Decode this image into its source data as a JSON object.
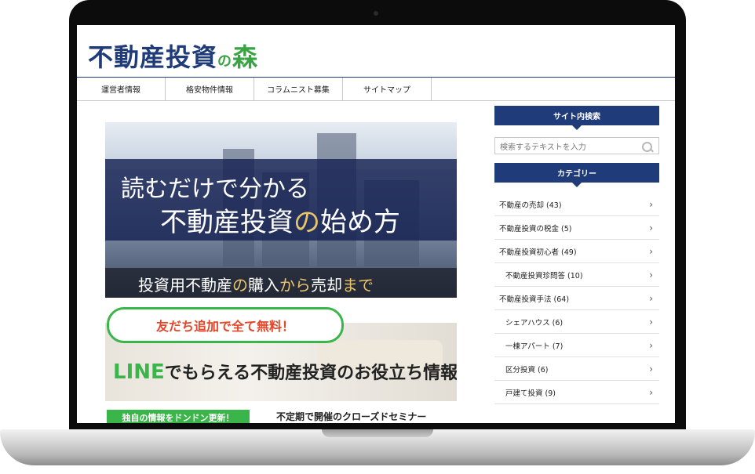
{
  "site": {
    "logo": {
      "main": "不動産投資",
      "no": "の",
      "mori": "森"
    }
  },
  "nav": {
    "items": [
      "運営者情報",
      "格安物件情報",
      "コラムニスト募集",
      "サイトマップ"
    ]
  },
  "banner1": {
    "line1": "読むだけで分かる",
    "line2": "不動産投資",
    "line2_no": "の",
    "line2_tail": "始め方",
    "line3_a": "投資用不動産",
    "line3_b": "の",
    "line3_c": "購入",
    "line3_d": "から",
    "line3_e": "売却",
    "line3_f": "まで"
  },
  "banner2": {
    "pill": "友だち追加で全て無料！",
    "line_word": "LINE",
    "rest": "でもらえる不動産投資のお役立ち情報"
  },
  "bottom": {
    "green_tag": "独自の情報をドンドン更新！",
    "seminar": "不定期で開催のクローズドセミナー"
  },
  "sidebar": {
    "search_title": "サイト内検索",
    "search_placeholder": "検索するテキストを入力",
    "category_title": "カテゴリー",
    "categories": [
      {
        "label": "不動産の売却 (43)",
        "indent": false
      },
      {
        "label": "不動産投資の税金 (5)",
        "indent": false
      },
      {
        "label": "不動産投資初心者 (49)",
        "indent": false
      },
      {
        "label": "不動産投資珍問答 (10)",
        "indent": true
      },
      {
        "label": "不動産投資手法 (64)",
        "indent": false
      },
      {
        "label": "シェアハウス (6)",
        "indent": true
      },
      {
        "label": "一棟アパート (7)",
        "indent": true
      },
      {
        "label": "区分投資 (6)",
        "indent": true
      },
      {
        "label": "戸建て投資 (9)",
        "indent": true
      }
    ]
  },
  "colors": {
    "brand": "#1f3b7a",
    "green": "#3ab54a",
    "red": "#e4462a",
    "gold": "#e8c46b"
  }
}
